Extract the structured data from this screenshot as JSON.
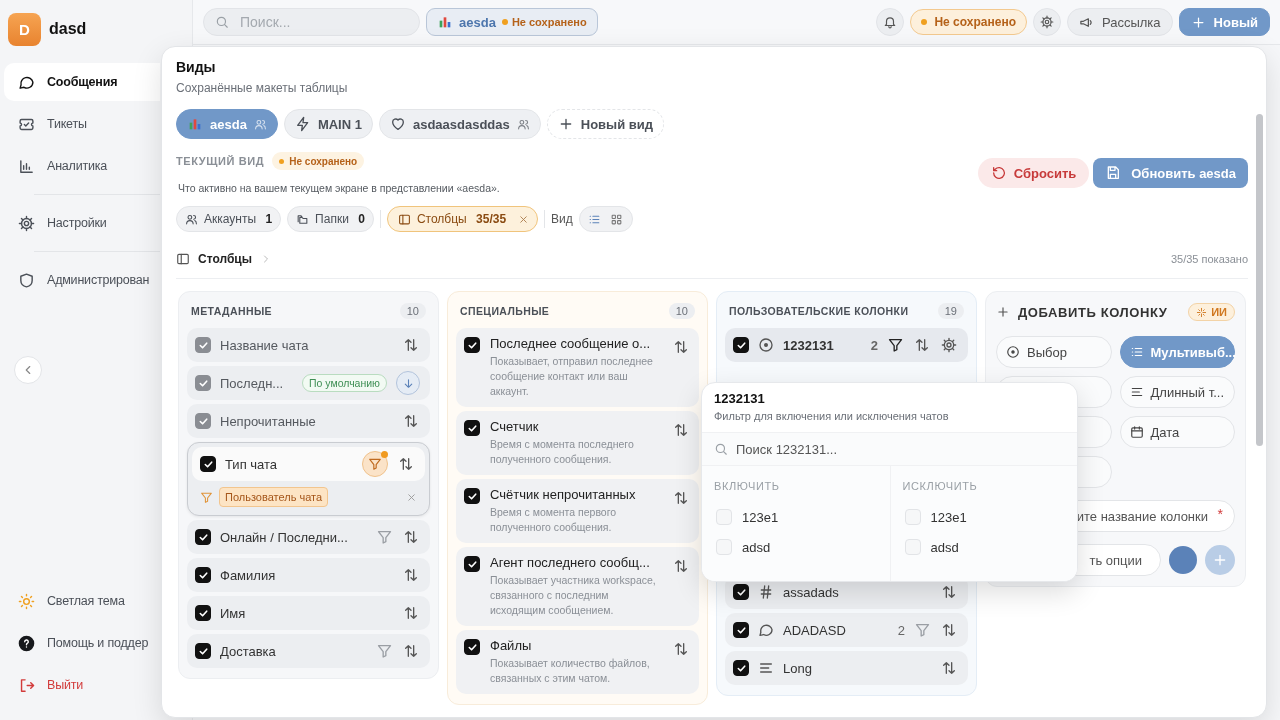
{
  "sidebar": {
    "logo_letter": "D",
    "workspace": "dasd",
    "nav_groups": [
      [
        {
          "label": "Сообщения",
          "selected": true
        },
        {
          "label": "Тикеты",
          "selected": false
        },
        {
          "label": "Аналитика",
          "selected": false
        }
      ],
      [
        {
          "label": "Настройки",
          "selected": false
        }
      ],
      [
        {
          "label": "Администрирован",
          "selected": false
        }
      ]
    ],
    "bottom": [
      {
        "label": "Светлая тема",
        "kind": "normal"
      },
      {
        "label": "Помощь и поддер",
        "kind": "normal"
      },
      {
        "label": "Выйти",
        "kind": "danger"
      }
    ]
  },
  "topbar": {
    "search": {
      "placeholder": "Поиск..."
    },
    "view_chip": {
      "name": "aesda",
      "status": "Не сохранено"
    },
    "status_badge": "Не сохранено",
    "buttons": [
      {
        "label": "Рассылка",
        "kind": "secondary"
      },
      {
        "label": "Новый",
        "kind": "primary"
      }
    ]
  },
  "views_panel": {
    "title": "Виды",
    "subtitle": "Сохранённые макеты таблицы",
    "views": [
      {
        "label": "aesda",
        "shared": true,
        "selected": true
      },
      {
        "label": "MAIN 1",
        "shared": false,
        "selected": false
      },
      {
        "label": "asdaasdasddas",
        "shared": true,
        "selected": false
      }
    ],
    "new_view": "Новый вид",
    "current_view": {
      "label": "ТЕКУЩИЙ ВИД",
      "status": "Не сохранено",
      "description": "Что активно на вашем текущем экране в представлении «aesda».",
      "reset": "Сбросить",
      "update": "Обновить aesda"
    },
    "chips": [
      {
        "label": "Аккаунты",
        "count": "1",
        "selected": false
      },
      {
        "label": "Папки",
        "count": "0",
        "selected": false
      },
      {
        "label": "Столбцы",
        "count": "35/35",
        "selected": true
      }
    ],
    "layout_toggle": {
      "label": "Вид",
      "options": [
        {
          "selected": true
        },
        {
          "selected": false
        }
      ]
    },
    "breadcrumb": "Столбцы",
    "shown": "35/35 показано",
    "metadata": {
      "title": "МЕТАДАННЫЕ",
      "count": "10",
      "items": [
        {
          "label": "Название чата",
          "checked": true,
          "disabled": true,
          "filter": false,
          "sorted": false
        },
        {
          "label": "Последн...",
          "checked": true,
          "disabled": true,
          "filter": false,
          "badge": "По умолчанию",
          "sorted": true
        },
        {
          "label": "Непрочитанные",
          "checked": true,
          "disabled": true,
          "filter": false,
          "sorted": false
        },
        {
          "label": "Тип чата",
          "checked": true,
          "disabled": false,
          "filter": true,
          "filter_active": true,
          "filter_values": [
            "Пользователь чата"
          ],
          "sorted": false
        },
        {
          "label": "Онлайн / Последни...",
          "checked": true,
          "disabled": false,
          "filter": true,
          "filter_active": false,
          "sorted": false
        },
        {
          "label": "Фамилия",
          "checked": true,
          "disabled": false,
          "filter": false,
          "sorted": false
        },
        {
          "label": "Имя",
          "checked": true,
          "disabled": false,
          "filter": false,
          "sorted": false
        },
        {
          "label": "Доставка",
          "checked": true,
          "disabled": false,
          "filter": true,
          "filter_active": false,
          "sorted": false
        }
      ]
    },
    "special": {
      "title": "СПЕЦИАЛЬНЫЕ",
      "count": "10",
      "items": [
        {
          "label": "Последнее сообщение о...",
          "description": "Показывает, отправил последнее сообщение контакт или ваш аккаунт.",
          "checked": true
        },
        {
          "label": "Счетчик",
          "description": "Время с момента последнего полученного сообщения.",
          "checked": true
        },
        {
          "label": "Счётчик непрочитанных",
          "description": "Время с момента первого полученного сообщения.",
          "checked": true
        },
        {
          "label": "Агент последнего сообщ...",
          "description": "Показывает участника workspace, связанного с последним исходящим сообщением.",
          "checked": true
        },
        {
          "label": "Файлы",
          "description": "Показывает количество файлов, связанных с этим чатом.",
          "checked": true
        }
      ]
    },
    "custom": {
      "title": "ПОЛЬЗОВАТЕЛЬСКИЕ КОЛОНКИ",
      "count": "19",
      "items": [
        {
          "label": "1232131",
          "kind": "choice",
          "count": "2",
          "filter": true,
          "filter_active": true,
          "settings": true,
          "checked": true
        },
        {
          "label": "assadads",
          "kind": "number",
          "filter": false,
          "checked": true
        },
        {
          "label": "ADADASD",
          "kind": "message",
          "count": "2",
          "filter": true,
          "filter_active": false,
          "checked": true
        },
        {
          "label": "Long",
          "kind": "text",
          "filter": false,
          "checked": true
        }
      ]
    },
    "filter_popup": {
      "title": "1232131",
      "subtitle": "Фильтр для включения или исключения чатов",
      "search_placeholder": "Поиск 1232131...",
      "columns": [
        {
          "label": "ВКЛЮЧИТЬ",
          "options": [
            {
              "label": "123e1",
              "checked": false
            },
            {
              "label": "adsd",
              "checked": false
            }
          ]
        },
        {
          "label": "ИСКЛЮЧИТЬ",
          "options": [
            {
              "label": "123e1",
              "checked": false
            },
            {
              "label": "adsd",
              "checked": false
            }
          ]
        }
      ]
    },
    "add_column": {
      "title": "ДОБАВИТЬ КОЛОНКУ",
      "ai_badge": "ИИ",
      "types_left": [
        {
          "label": "Выбор",
          "kind": "choice",
          "selected": false
        }
      ],
      "types_right": [
        {
          "label": "Мультивыб...",
          "kind": "multi",
          "selected": true
        },
        {
          "label": "Длинный т...",
          "kind": "text",
          "selected": false
        },
        {
          "label": "Дата",
          "kind": "date",
          "selected": false
        }
      ],
      "name_placeholder": "ите название колонки",
      "required_mark": "*",
      "options_placeholder": "ть опции",
      "color": "#5b82b8",
      "add_disabled": true
    }
  }
}
